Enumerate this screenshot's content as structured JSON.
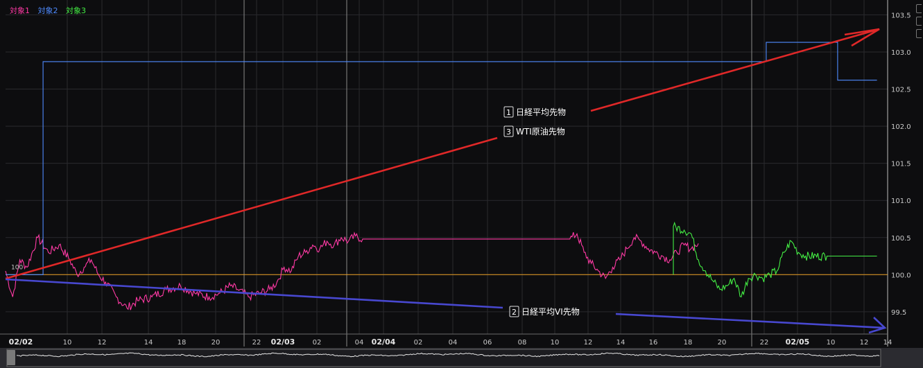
{
  "legend": [
    {
      "label": "対象1",
      "color": "#ff3aa5"
    },
    {
      "label": "対象2",
      "color": "#4f8bff"
    },
    {
      "label": "対象3",
      "color": "#44ee44"
    }
  ],
  "annotations": [
    {
      "num": "1",
      "text": "日経平均先物"
    },
    {
      "num": "3",
      "text": "WTI原油先物"
    },
    {
      "num": "2",
      "text": "日経平均VI先物"
    }
  ],
  "colors": {
    "bg": "#0d0d0f",
    "grid": "#2a2a2e",
    "axis": "#c9c9c9",
    "baseline": "#e9a020",
    "arrow_red": "#e02828",
    "arrow_blue": "#4848d0"
  },
  "chart_data": {
    "type": "line",
    "ylim": [
      99.2,
      103.7
    ],
    "y_ticks": [
      "103.5",
      "103.0",
      "102.5",
      "102.0",
      "101.5",
      "101.0",
      "100.5",
      "100.0",
      "99.5"
    ],
    "baseline_label": "100",
    "baseline_value": 100,
    "x_ticks": [
      {
        "label": "02/02",
        "bold": true
      },
      {
        "label": "10"
      },
      {
        "label": "12"
      },
      {
        "label": "14"
      },
      {
        "label": "18"
      },
      {
        "label": "20"
      },
      {
        "label": "22"
      },
      {
        "label": "02/03",
        "bold": true
      },
      {
        "label": "02"
      },
      {
        "label": "04"
      },
      {
        "label": "02/04",
        "bold": true
      },
      {
        "label": "02"
      },
      {
        "label": "04"
      },
      {
        "label": "06"
      },
      {
        "label": "08"
      },
      {
        "label": "10"
      },
      {
        "label": "12"
      },
      {
        "label": "14"
      },
      {
        "label": "16"
      },
      {
        "label": "18"
      },
      {
        "label": "20"
      },
      {
        "label": "22"
      },
      {
        "label": "02/05",
        "bold": true
      },
      {
        "label": "10"
      },
      {
        "label": "12"
      },
      {
        "label": "14"
      }
    ],
    "series": [
      {
        "legend_index": 0,
        "color": "#ff3aa5",
        "points": [
          [
            0,
            100.05
          ],
          [
            0.02,
            99.7
          ],
          [
            0.04,
            100.2
          ],
          [
            0.06,
            100.1
          ],
          [
            0.09,
            100.5
          ],
          [
            0.12,
            100.3
          ],
          [
            0.15,
            100.4
          ],
          [
            0.18,
            100.2
          ],
          [
            0.2,
            100.0
          ],
          [
            0.22,
            100.1
          ],
          [
            0.24,
            100.2
          ],
          [
            0.26,
            100.0
          ],
          [
            0.28,
            99.9
          ],
          [
            0.31,
            99.7
          ],
          [
            0.34,
            99.55
          ],
          [
            0.37,
            99.65
          ],
          [
            0.41,
            99.7
          ],
          [
            0.45,
            99.8
          ],
          [
            0.49,
            99.85
          ],
          [
            0.53,
            99.75
          ],
          [
            0.57,
            99.7
          ],
          [
            0.6,
            99.75
          ],
          [
            0.63,
            99.85
          ],
          [
            0.65,
            99.8
          ],
          [
            0.68,
            99.7
          ],
          [
            0.71,
            99.75
          ],
          [
            0.74,
            99.8
          ],
          [
            0.76,
            99.9
          ],
          [
            0.78,
            100.1
          ],
          [
            0.8,
            100.05
          ],
          [
            0.82,
            100.25
          ],
          [
            0.84,
            100.3
          ],
          [
            0.86,
            100.4
          ],
          [
            0.88,
            100.35
          ],
          [
            0.9,
            100.45
          ],
          [
            0.92,
            100.4
          ],
          [
            0.94,
            100.5
          ],
          [
            0.96,
            100.45
          ],
          [
            0.98,
            100.52
          ],
          [
            1.0,
            100.48
          ],
          [
            1.58,
            100.48
          ],
          [
            1.6,
            100.55
          ],
          [
            1.62,
            100.3
          ],
          [
            1.64,
            100.15
          ],
          [
            1.66,
            100.05
          ],
          [
            1.68,
            99.95
          ],
          [
            1.7,
            100.1
          ],
          [
            1.72,
            100.2
          ],
          [
            1.74,
            100.35
          ],
          [
            1.76,
            100.5
          ],
          [
            1.78,
            100.45
          ],
          [
            1.8,
            100.35
          ],
          [
            1.82,
            100.3
          ],
          [
            1.84,
            100.25
          ],
          [
            1.86,
            100.2
          ],
          [
            1.88,
            100.3
          ],
          [
            1.9,
            100.4
          ],
          [
            1.92,
            100.35
          ],
          [
            1.94,
            100.42
          ]
        ]
      },
      {
        "legend_index": 1,
        "color": "#4f8bff",
        "points": [
          [
            0,
            100.0
          ],
          [
            0.105,
            100.0
          ],
          [
            0.105,
            102.87
          ],
          [
            2.13,
            102.87
          ],
          [
            2.13,
            103.13
          ],
          [
            2.33,
            103.13
          ],
          [
            2.33,
            102.62
          ],
          [
            2.44,
            102.62
          ]
        ]
      },
      {
        "legend_index": 2,
        "color": "#44ee44",
        "points": [
          [
            1.87,
            100.0
          ],
          [
            1.87,
            100.65
          ],
          [
            1.9,
            100.6
          ],
          [
            1.92,
            100.55
          ],
          [
            1.94,
            100.2
          ],
          [
            1.96,
            100.05
          ],
          [
            1.98,
            99.92
          ],
          [
            2.0,
            99.8
          ],
          [
            2.02,
            99.85
          ],
          [
            2.04,
            99.95
          ],
          [
            2.06,
            99.7
          ],
          [
            2.08,
            99.95
          ],
          [
            2.1,
            100.0
          ],
          [
            2.12,
            99.95
          ],
          [
            2.14,
            100.0
          ],
          [
            2.16,
            100.05
          ],
          [
            2.18,
            100.3
          ],
          [
            2.2,
            100.45
          ],
          [
            2.22,
            100.3
          ],
          [
            2.24,
            100.25
          ],
          [
            2.3,
            100.25
          ],
          [
            2.44,
            100.25
          ]
        ]
      }
    ]
  }
}
